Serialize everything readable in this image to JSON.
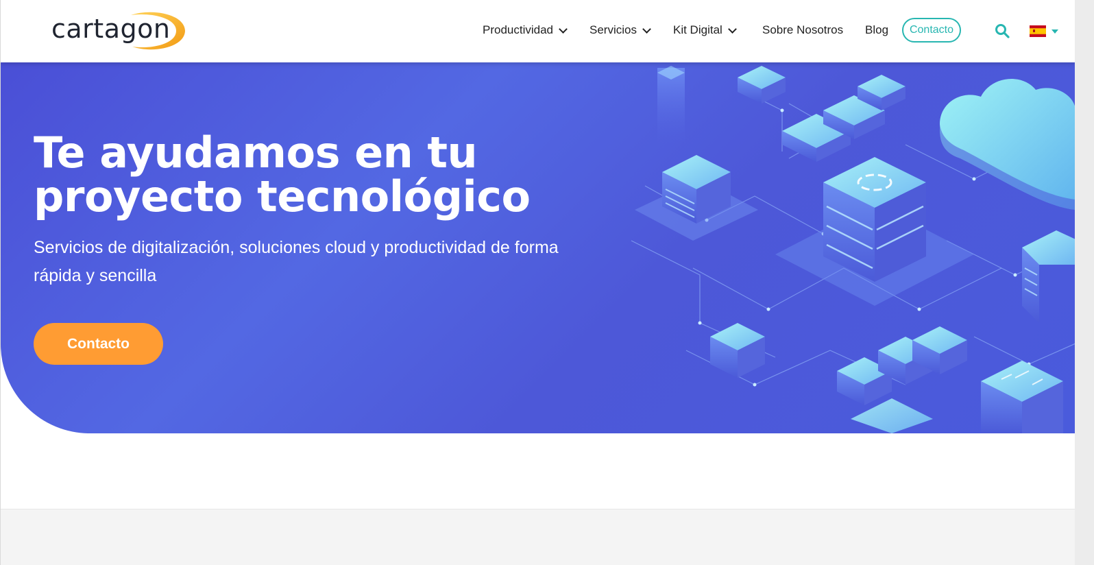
{
  "header": {
    "logo_text": "cartagon",
    "nav": [
      {
        "label": "Productividad",
        "dropdown": true
      },
      {
        "label": "Servicios",
        "dropdown": true
      },
      {
        "label": "Kit Digital",
        "dropdown": true
      },
      {
        "label": "Sobre Nosotros",
        "dropdown": false
      },
      {
        "label": "Blog",
        "dropdown": false
      }
    ],
    "contact_label": "Contacto",
    "search_icon": "search-icon",
    "language_icon": "spain-flag-icon"
  },
  "hero": {
    "title": "Te ayudamos en tu proyecto tecnológico",
    "subtitle": "Servicios de digitalización, soluciones cloud y productividad de forma rápida y sencilla",
    "cta_label": "Contacto"
  },
  "colors": {
    "accent_teal": "#27b6b1",
    "hero_blue": "#4d58d8",
    "cta_orange": "#ff9c33",
    "logo_orange": "#f5a623"
  }
}
